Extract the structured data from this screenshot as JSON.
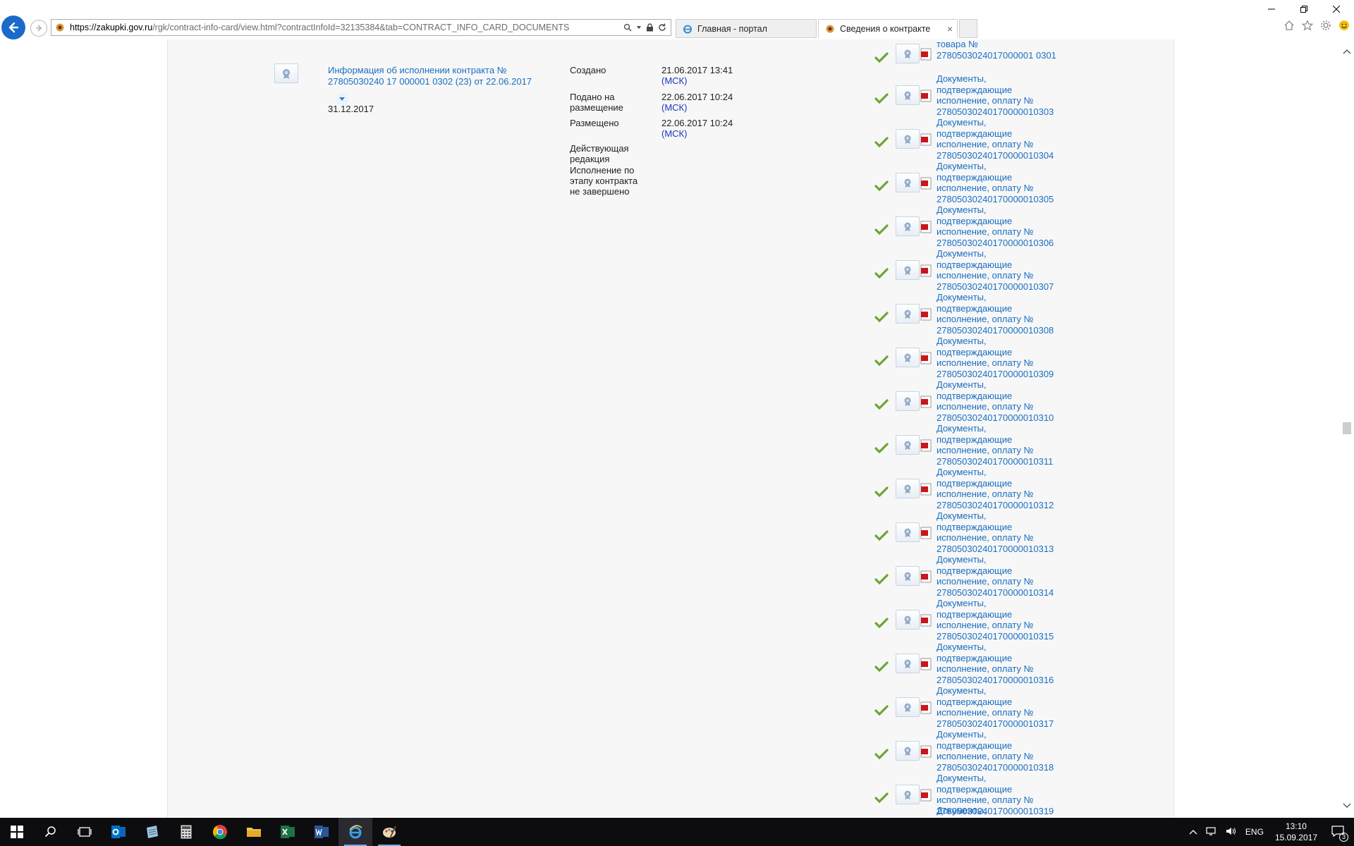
{
  "browser": {
    "url_host": "https://zakupki.gov.ru",
    "url_path": "/rgk/contract-info-card/view.html?contractInfoId=32135384&tab=CONTRACT_INFO_CARD_DOCUMENTS",
    "tabs": [
      {
        "label": "Главная - портал",
        "active": false
      },
      {
        "label": "Сведения о контракте",
        "active": true
      }
    ],
    "tab_close_glyph": "×"
  },
  "document": {
    "title": "Информация об исполнении контракта № 27805030240 17 000001 0302 (23) от 22.06.2017",
    "date": "31.12.2017",
    "meta": [
      {
        "label": "Создано",
        "value": "21.06.2017 13:41",
        "tz": "(МСК)"
      },
      {
        "label": "Подано на размещение",
        "value": "22.06.2017 10:24",
        "tz": "(МСК)"
      },
      {
        "label": "Размещено",
        "value": "22.06.2017 10:24",
        "tz": "(МСК)"
      },
      {
        "label": "Действующая редакция",
        "value": "",
        "tz": ""
      },
      {
        "label": "Исполнение по этапу контракта не завершено",
        "value": "",
        "tz": ""
      }
    ]
  },
  "attachments": {
    "first_partial": "товара № 2780503024017000001 0301",
    "items": [
      {
        "text": "Документы, подтверждающие исполнение, оплату № 27805030240170000010303"
      },
      {
        "text": "Документы, подтверждающие исполнение, оплату № 27805030240170000010304"
      },
      {
        "text": "Документы, подтверждающие исполнение, оплату № 27805030240170000010305"
      },
      {
        "text": "Документы, подтверждающие исполнение, оплату № 27805030240170000010306"
      },
      {
        "text": "Документы, подтверждающие исполнение, оплату № 27805030240170000010307"
      },
      {
        "text": "Документы, подтверждающие исполнение, оплату № 27805030240170000010308"
      },
      {
        "text": "Документы, подтверждающие исполнение, оплату № 27805030240170000010309"
      },
      {
        "text": "Документы, подтверждающие исполнение, оплату № 27805030240170000010310"
      },
      {
        "text": "Документы, подтверждающие исполнение, оплату № 27805030240170000010311"
      },
      {
        "text": "Документы, подтверждающие исполнение, оплату № 27805030240170000010312"
      },
      {
        "text": "Документы, подтверждающие исполнение, оплату № 27805030240170000010313"
      },
      {
        "text": "Документы, подтверждающие исполнение, оплату № 27805030240170000010314"
      },
      {
        "text": "Документы, подтверждающие исполнение, оплату № 27805030240170000010315"
      },
      {
        "text": "Документы, подтверждающие исполнение, оплату № 27805030240170000010316"
      },
      {
        "text": "Документы, подтверждающие исполнение, оплату № 27805030240170000010317"
      },
      {
        "text": "Документы, подтверждающие исполнение, оплату № 27805030240170000010318"
      },
      {
        "text": "Документы, подтверждающие исполнение, оплату № 27805030240170000010319"
      }
    ],
    "last_partial": "Документы,"
  },
  "taskbar": {
    "apps": [
      "windows-start-icon",
      "search-icon",
      "task-view-icon",
      "outlook-icon",
      "notepad-icon",
      "calculator-icon",
      "chrome-icon",
      "file-explorer-icon",
      "excel-icon",
      "word-icon",
      "internet-explorer-icon",
      "paint-icon"
    ],
    "lang": "ENG",
    "time": "13:10",
    "date": "15.09.2017",
    "notification_count": "3"
  },
  "colors": {
    "link": "#1a6fc2",
    "tz": "#1a35c2",
    "check": "#6ca633",
    "pdf": "#c8161d",
    "taskbar": "#0d0d10"
  }
}
